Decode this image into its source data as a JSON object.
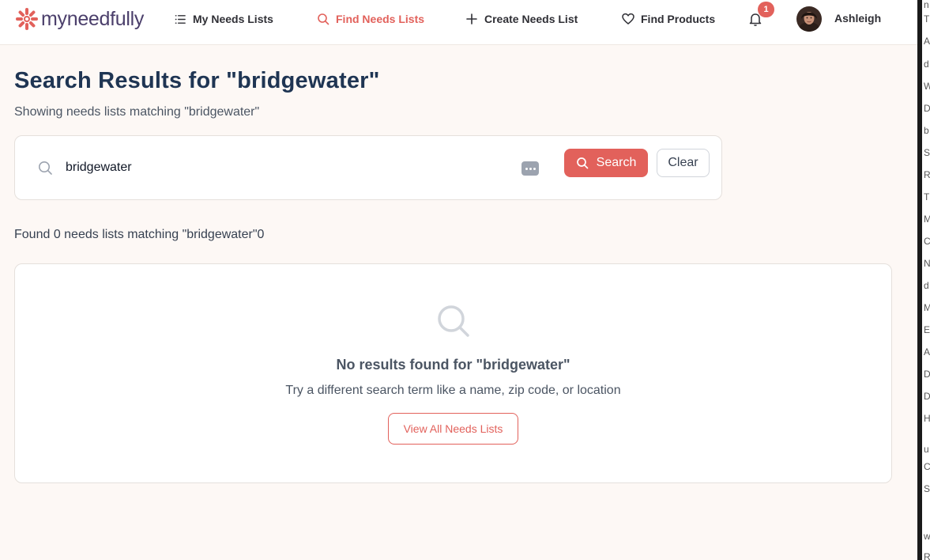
{
  "brand": {
    "name": "myneedfully",
    "accent_color": "#e2615b",
    "logo_color": "#4b3f6b"
  },
  "nav": {
    "items": [
      {
        "label": "My Needs Lists",
        "icon": "list-icon",
        "active": false
      },
      {
        "label": "Find Needs Lists",
        "icon": "search-icon",
        "active": true
      },
      {
        "label": "Create Needs List",
        "icon": "plus-icon",
        "active": false
      },
      {
        "label": "Find Products",
        "icon": "heart-icon",
        "active": false
      }
    ],
    "notification_count": "1",
    "user_name": "Ashleigh"
  },
  "page": {
    "title": "Search Results for \"bridgewater\"",
    "subtitle": "Showing needs lists matching \"bridgewater\""
  },
  "search": {
    "value": "bridgewater",
    "search_button_label": "Search",
    "clear_button_label": "Clear"
  },
  "results": {
    "found_text": "Found 0 needs lists matching \"bridgewater\"0",
    "empty_title": "No results found for \"bridgewater\"",
    "empty_subtitle": "Try a different search term like a name, zip code, or location",
    "view_all_label": "View All Needs Lists"
  },
  "side_panel_letters": [
    "n",
    "T",
    "A",
    "d",
    "W",
    "D",
    "b",
    "S",
    "R",
    "T",
    "M",
    "C",
    "N",
    "d",
    "M",
    "E",
    "A",
    "D",
    "D",
    "H",
    "u",
    "C",
    "S",
    "w",
    "R"
  ]
}
